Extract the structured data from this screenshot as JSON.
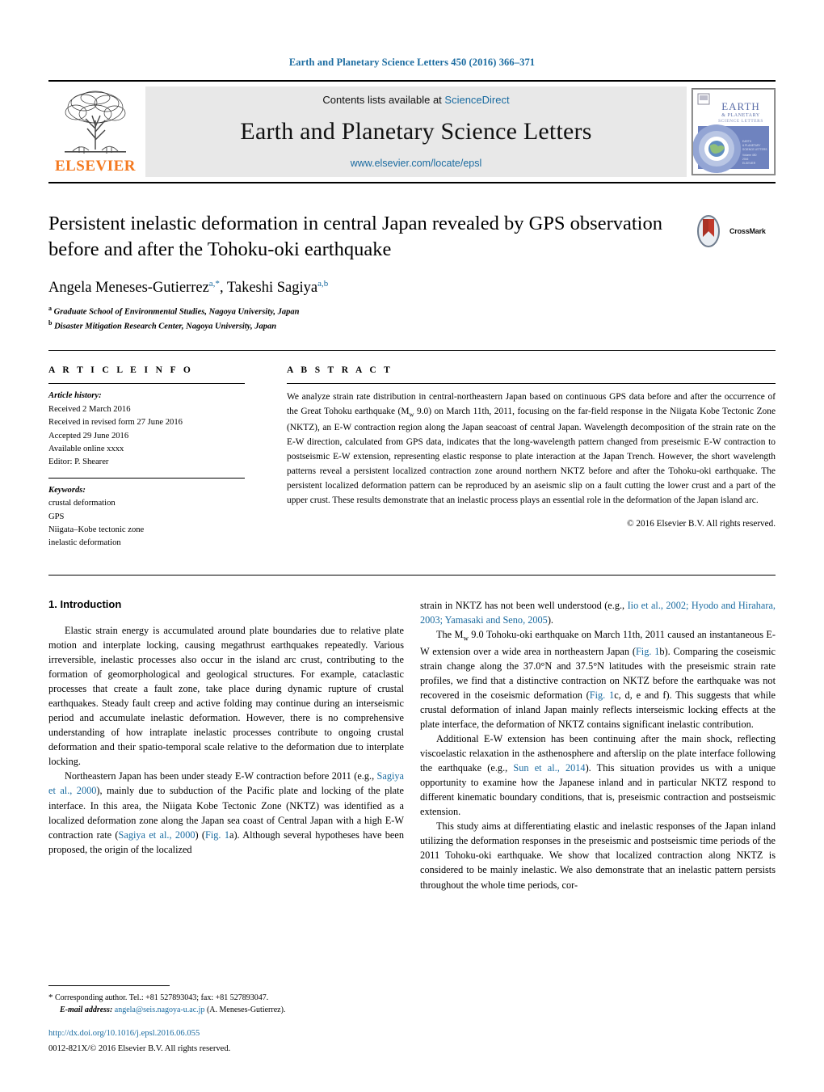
{
  "running_head": "Earth and Planetary Science Letters 450 (2016) 366–371",
  "masthead": {
    "publisher_name": "ELSEVIER",
    "contents_prefix": "Contents lists available at ",
    "contents_link": "ScienceDirect",
    "journal_name": "Earth and Planetary Science Letters",
    "journal_url": "www.elsevier.com/locate/epsl",
    "cover_title_line1": "EARTH",
    "cover_title_line2": "& PLANETARY",
    "cover_title_line3": "SCIENCE LETTERS"
  },
  "article": {
    "title": "Persistent inelastic deformation in central Japan revealed by GPS observation before and after the Tohoku-oki earthquake",
    "crossmark_label": "CrossMark",
    "authors_html": "Angela Meneses-Gutierrez<sup>a,*</sup>, Takeshi Sagiya<sup>a,b</sup>",
    "affiliations": [
      {
        "marker": "a",
        "text": "Graduate School of Environmental Studies, Nagoya University, Japan"
      },
      {
        "marker": "b",
        "text": "Disaster Mitigation Research Center, Nagoya University, Japan"
      }
    ]
  },
  "article_info": {
    "heading": "A R T I C L E   I N F O",
    "history_title": "Article history:",
    "history": [
      "Received 2 March 2016",
      "Received in revised form 27 June 2016",
      "Accepted 29 June 2016",
      "Available online xxxx",
      "Editor: P. Shearer"
    ],
    "keywords_title": "Keywords:",
    "keywords": [
      "crustal deformation",
      "GPS",
      "Niigata–Kobe tectonic zone",
      "inelastic deformation"
    ]
  },
  "abstract": {
    "heading": "A B S T R A C T",
    "text_html": "We analyze strain rate distribution in central-northeastern Japan based on continuous GPS data before and after the occurrence of the Great Tohoku earthquake (M<sub>w</sub> 9.0) on March 11th, 2011, focusing on the far-field response in the Niigata Kobe Tectonic Zone (NKTZ), an E-W contraction region along the Japan seacoast of central Japan. Wavelength decomposition of the strain rate on the E-W direction, calculated from GPS data, indicates that the long-wavelength pattern changed from preseismic E-W contraction to postseismic E-W extension, representing elastic response to plate interaction at the Japan Trench. However, the short wavelength patterns reveal a persistent localized contraction zone around northern NKTZ before and after the Tohoku-oki earthquake. The persistent localized deformation pattern can be reproduced by an aseismic slip on a fault cutting the lower crust and a part of the upper crust. These results demonstrate that an inelastic process plays an essential role in the deformation of the Japan island arc.",
    "copyright": "© 2016 Elsevier B.V. All rights reserved."
  },
  "body": {
    "section_title": "1. Introduction",
    "left_paragraphs_html": [
      "Elastic strain energy is accumulated around plate boundaries due to relative plate motion and interplate locking, causing megathrust earthquakes repeatedly. Various irreversible, inelastic processes also occur in the island arc crust, contributing to the formation of geomorphological and geological structures. For example, cataclastic processes that create a fault zone, take place during dynamic rupture of crustal earthquakes. Steady fault creep and active folding may continue during an interseismic period and accumulate inelastic deformation. However, there is no comprehensive understanding of how intraplate inelastic processes contribute to ongoing crustal deformation and their spatio-temporal scale relative to the deformation due to interplate locking.",
      "Northeastern Japan has been under steady E-W contraction before 2011 (e.g., <span class=\"ref\">Sagiya et al., 2000</span>), mainly due to subduction of the Pacific plate and locking of the plate interface. In this area, the Niigata Kobe Tectonic Zone (NKTZ) was identified as a localized deformation zone along the Japan sea coast of Central Japan with a high E-W contraction rate (<span class=\"ref\">Sagiya et al., 2000</span>) (<span class=\"ref\">Fig. 1</span>a). Although several hypotheses have been proposed, the origin of the localized"
    ],
    "right_paragraphs_html": [
      "strain in NKTZ has not been well understood (e.g., <span class=\"ref\">Iio et al., 2002; Hyodo and Hirahara, 2003; Yamasaki and Seno, 2005</span>).",
      "The M<sub>w</sub> 9.0 Tohoku-oki earthquake on March 11th, 2011 caused an instantaneous E-W extension over a wide area in northeastern Japan (<span class=\"ref\">Fig. 1</span>b). Comparing the coseismic strain change along the 37.0°N and 37.5°N latitudes with the preseismic strain rate profiles, we find that a distinctive contraction on NKTZ before the earthquake was not recovered in the coseismic deformation (<span class=\"ref\">Fig. 1</span>c, d, e and f). This suggests that while crustal deformation of inland Japan mainly reflects interseismic locking effects at the plate interface, the deformation of NKTZ contains significant inelastic contribution.",
      "Additional E-W extension has been continuing after the main shock, reflecting viscoelastic relaxation in the asthenosphere and afterslip on the plate interface following the earthquake (e.g., <span class=\"ref\">Sun et al., 2014</span>). This situation provides us with a unique opportunity to examine how the Japanese inland and in particular NKTZ respond to different kinematic boundary conditions, that is, preseismic contraction and postseismic extension.",
      "This study aims at differentiating elastic and inelastic responses of the Japan inland utilizing the deformation responses in the preseismic and postseismic time periods of the 2011 Tohoku-oki earthquake. We show that localized contraction along NKTZ is considered to be mainly inelastic. We also demonstrate that an inelastic pattern persists throughout the whole time periods, cor-"
    ]
  },
  "footnote": {
    "star": "*",
    "corresponding_text": "Corresponding author. Tel.: +81 527893043; fax: +81 527893047.",
    "email_label": "E-mail address:",
    "email": "angela@seis.nagoya-u.ac.jp",
    "email_suffix": "(A. Meneses-Gutierrez).",
    "doi": "http://dx.doi.org/10.1016/j.epsl.2016.06.055",
    "issn_line": "0012-821X/© 2016 Elsevier B.V. All rights reserved."
  },
  "colors": {
    "link": "#1a6ba0",
    "elsevier_orange": "#f47920",
    "masthead_bg": "#e8e8e8",
    "crossmark_red": "#c0392b"
  }
}
